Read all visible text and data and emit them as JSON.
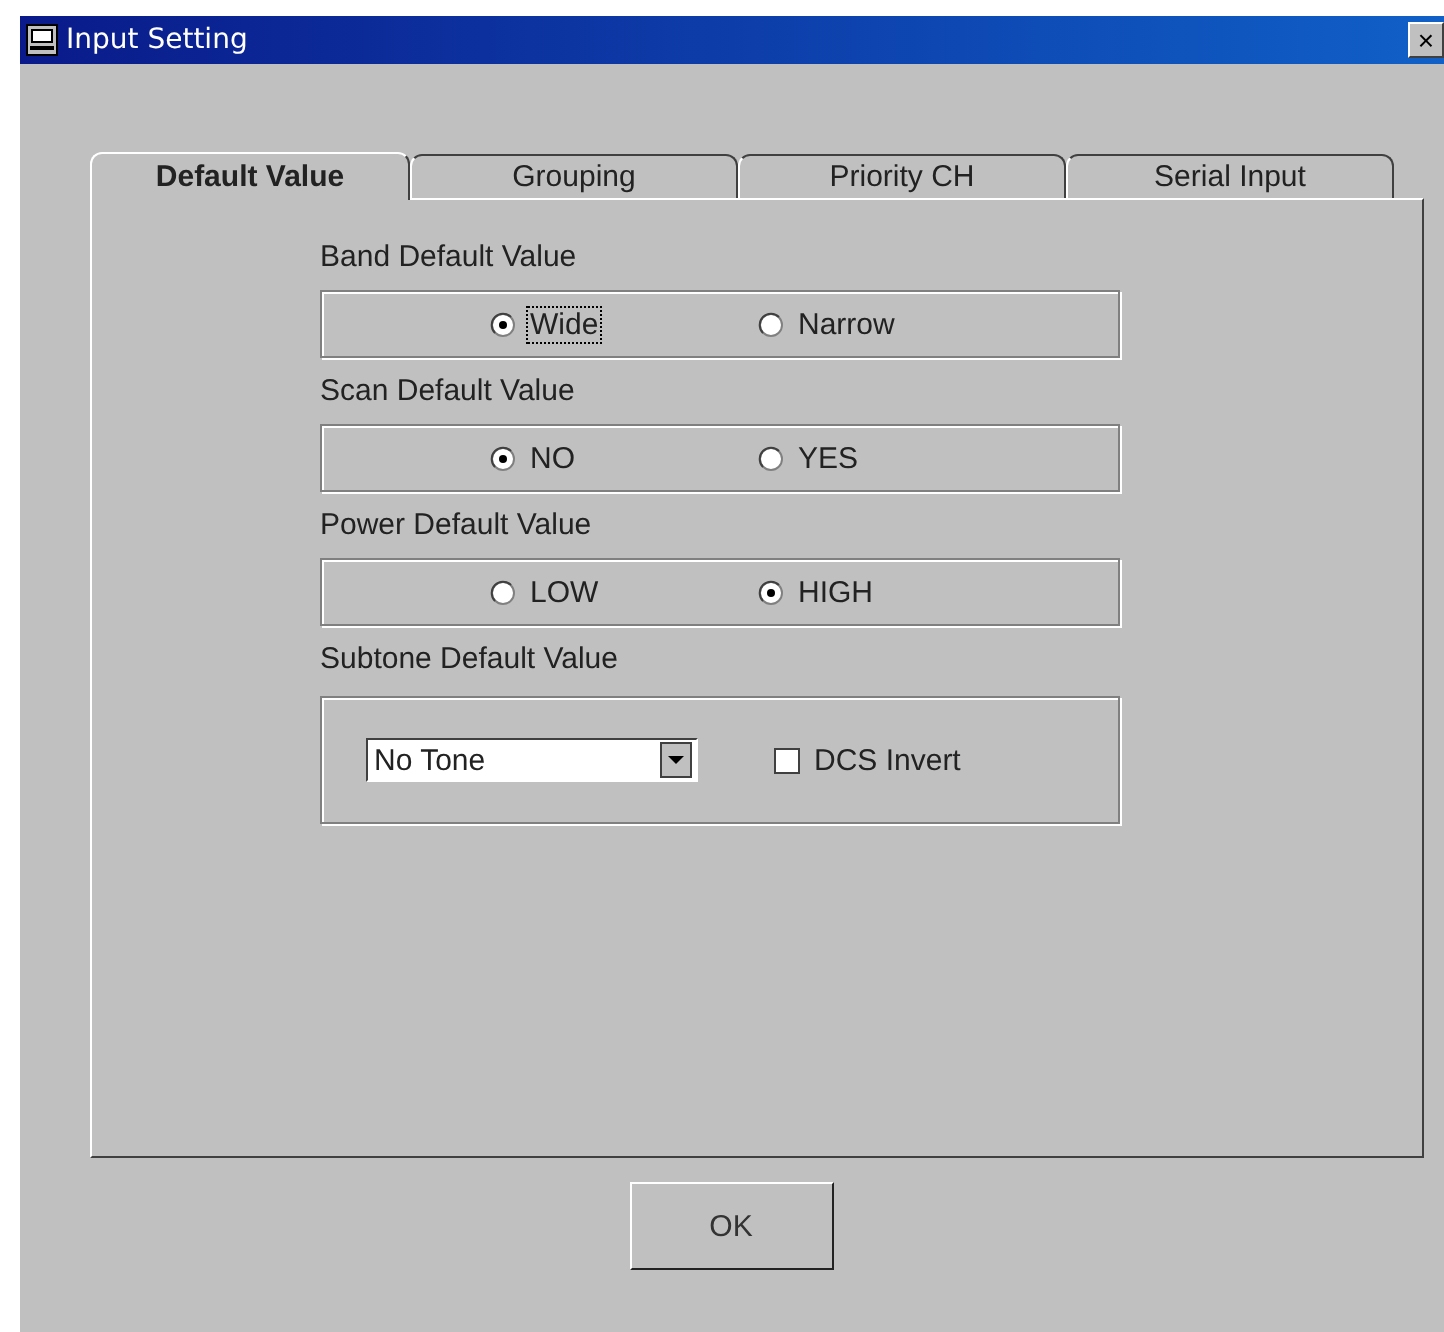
{
  "window": {
    "title": "Input Setting",
    "close": "×"
  },
  "tabs": [
    {
      "label": "Default Value",
      "selected": true
    },
    {
      "label": "Grouping",
      "selected": false
    },
    {
      "label": "Priority CH",
      "selected": false
    },
    {
      "label": "Serial Input",
      "selected": false
    }
  ],
  "groups": [
    {
      "kind": "radio",
      "label": "Band Default Value",
      "options": [
        {
          "label": "Wide",
          "selected": true,
          "focused": true
        },
        {
          "label": "Narrow",
          "selected": false,
          "focused": false
        }
      ]
    },
    {
      "kind": "radio",
      "label": "Scan Default Value",
      "options": [
        {
          "label": "NO",
          "selected": true,
          "focused": false
        },
        {
          "label": "YES",
          "selected": false,
          "focused": false
        }
      ]
    },
    {
      "kind": "radio",
      "label": "Power Default Value",
      "options": [
        {
          "label": "LOW",
          "selected": false,
          "focused": false
        },
        {
          "label": "HIGH",
          "selected": true,
          "focused": false
        }
      ]
    },
    {
      "kind": "subtone",
      "label": "Subtone Default Value",
      "dropdown": {
        "value": "No Tone"
      },
      "checkbox": {
        "label": "DCS Invert",
        "checked": false
      }
    }
  ],
  "buttons": [
    "OK"
  ]
}
